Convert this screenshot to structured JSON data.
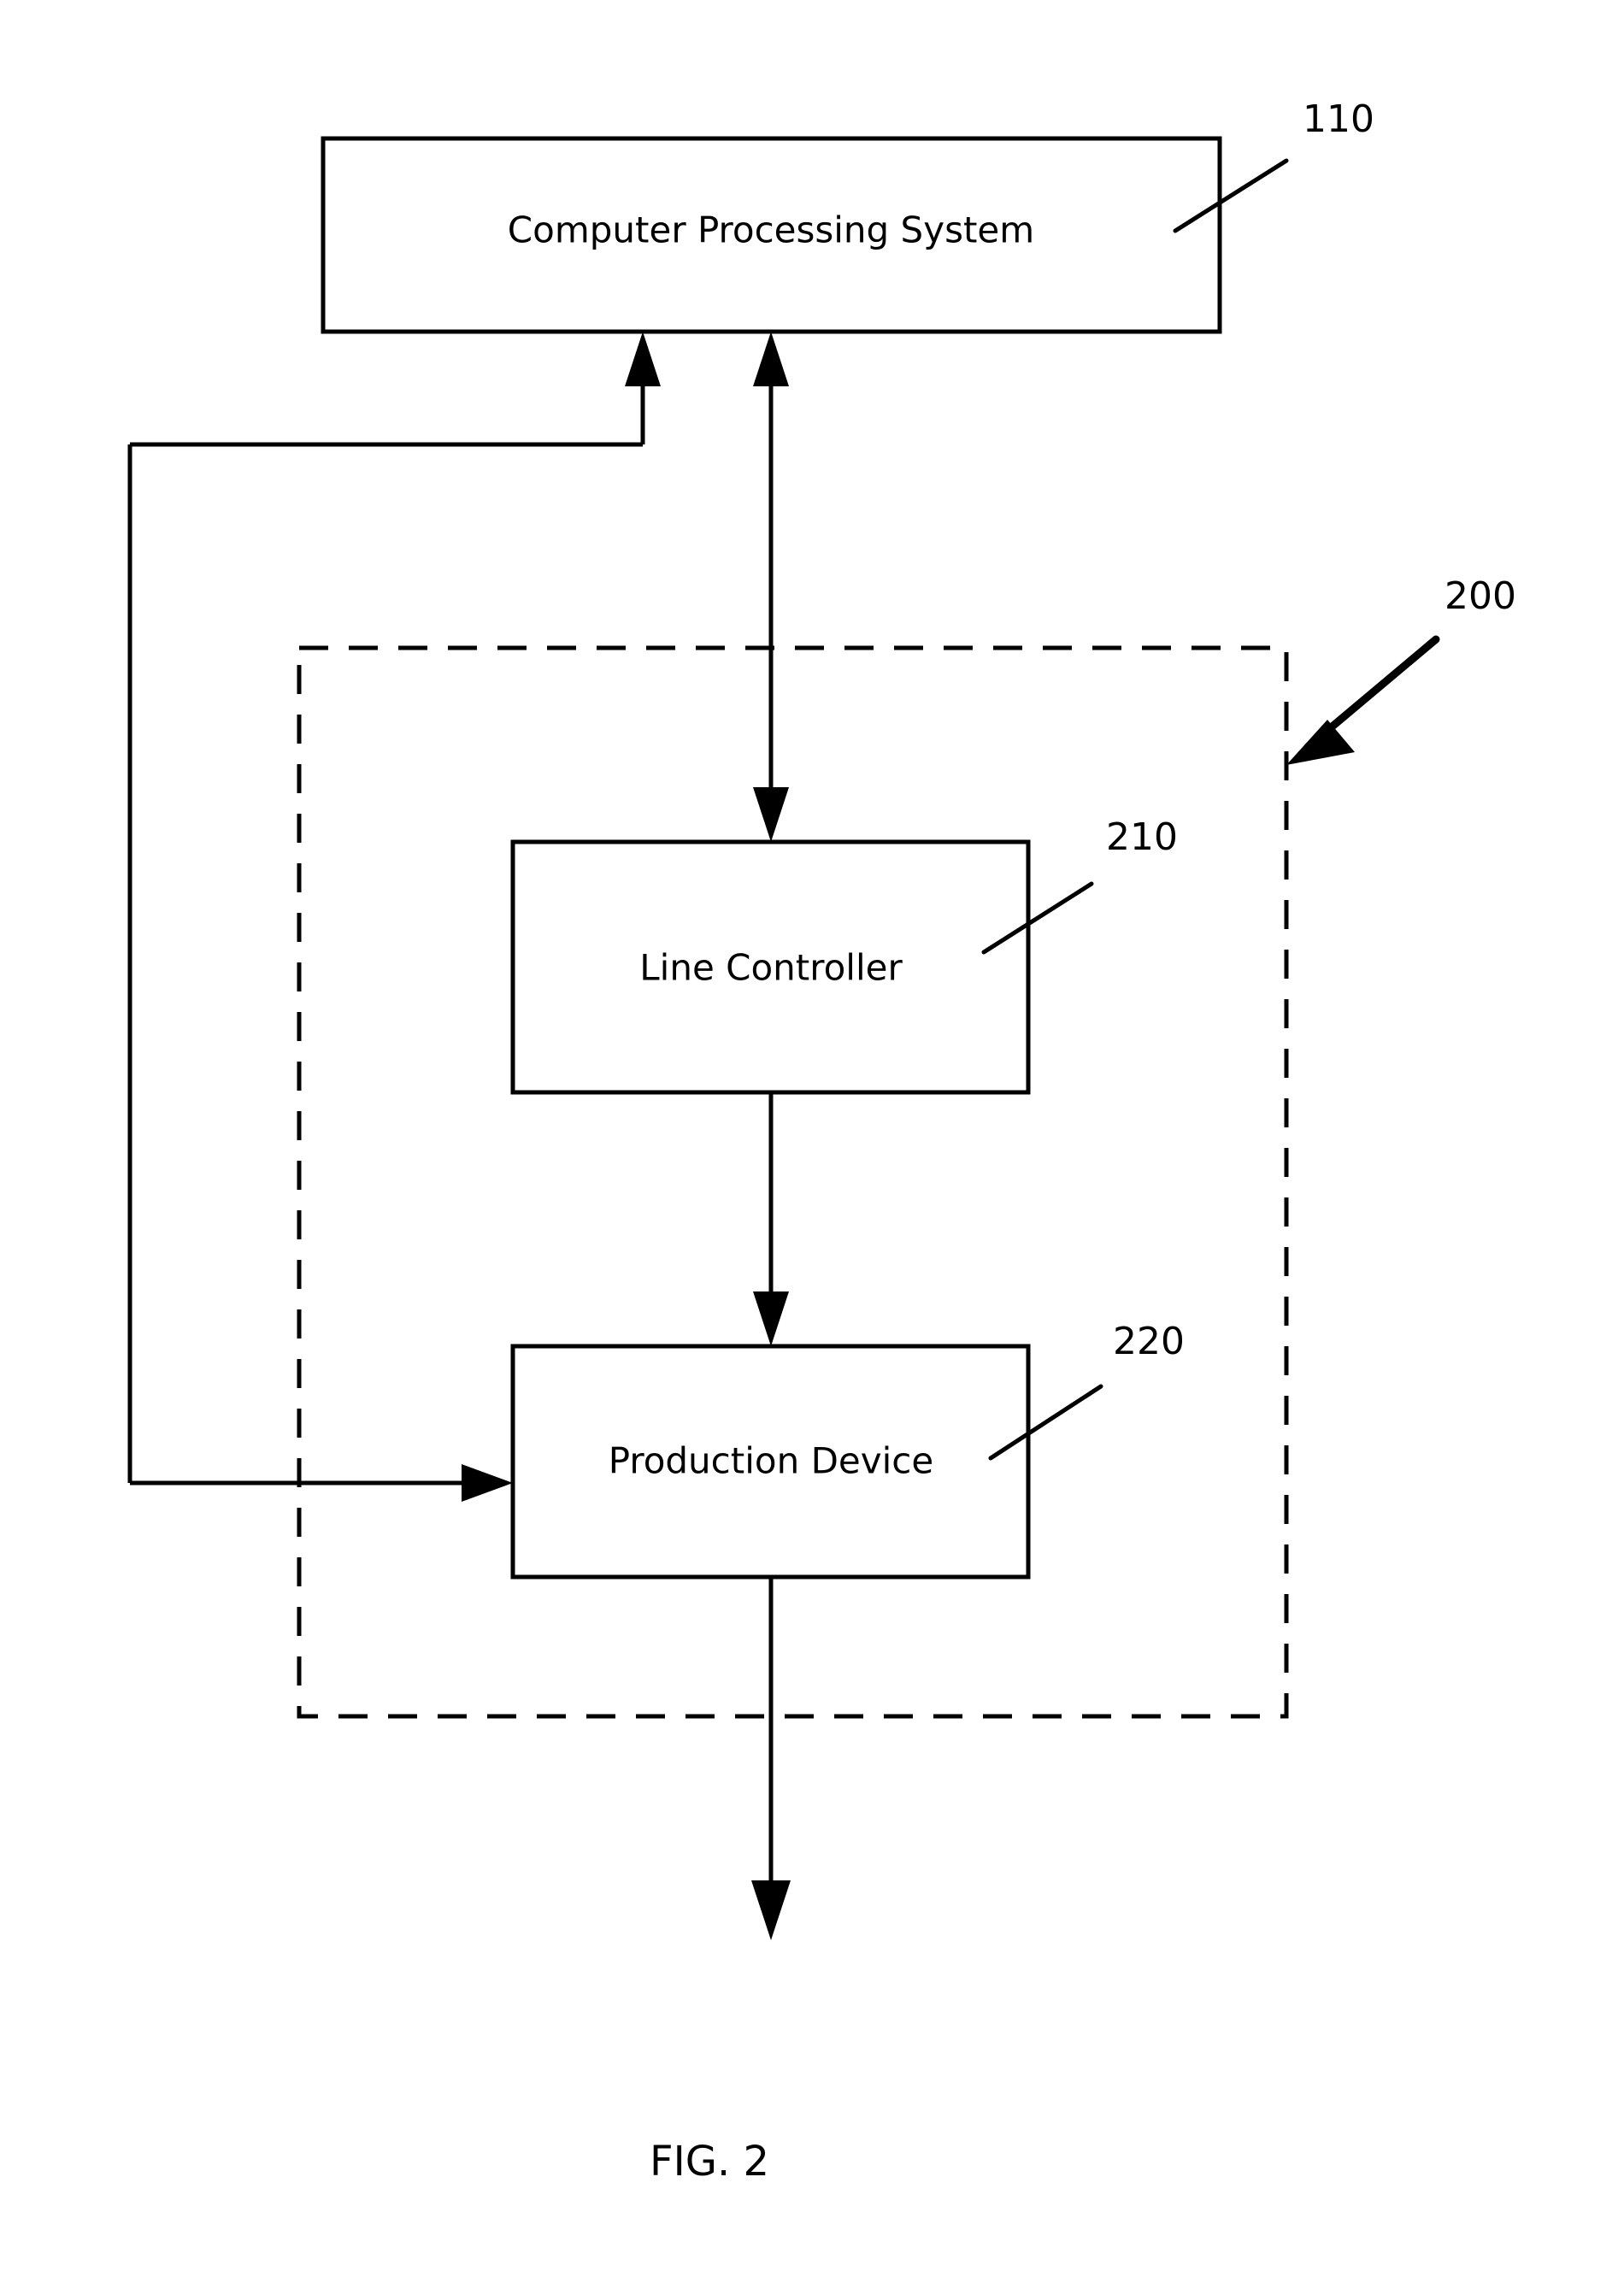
{
  "figure": {
    "caption": "FIG. 2",
    "blocks": [
      {
        "id": "computer-processing-system",
        "label": "Computer Processing System",
        "ref": "110"
      },
      {
        "id": "line-controller",
        "label": "Line Controller",
        "ref": "210"
      },
      {
        "id": "production-device",
        "label": "Production Device",
        "ref": "220"
      }
    ],
    "group": {
      "id": "production-line",
      "ref": "200",
      "style": "dashed"
    },
    "connectors": [
      {
        "id": "cps-line-controller-bidirectional",
        "from": "computer-processing-system",
        "to": "line-controller",
        "arrows": "both"
      },
      {
        "id": "line-controller-production-device",
        "from": "line-controller",
        "to": "production-device",
        "arrows": "to"
      },
      {
        "id": "production-device-output",
        "from": "production-device",
        "to": "output",
        "arrows": "to"
      },
      {
        "id": "feedback-to-cps",
        "from": "feedback-bus",
        "to": "computer-processing-system",
        "arrows": "to"
      },
      {
        "id": "feedback-to-production-device",
        "from": "feedback-bus",
        "to": "production-device",
        "arrows": "to"
      }
    ]
  },
  "colors": {
    "stroke": "#000000",
    "background": "#ffffff"
  }
}
